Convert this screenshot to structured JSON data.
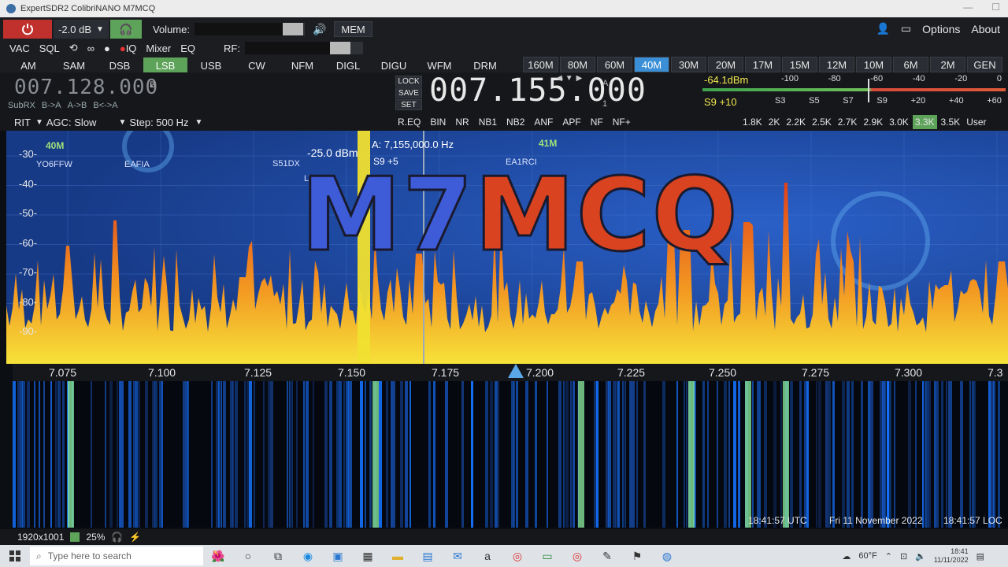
{
  "window": {
    "title": "ExpertSDR2 ColibriNANO    M7MCQ"
  },
  "toolbar": {
    "gain_value": "-2.0 dB",
    "volume_label": "Volume:",
    "volume_level": 0.75,
    "mem_label": "MEM",
    "rf_label": "RF:",
    "rf_level": 0.85,
    "options_label": "Options",
    "about_label": "About",
    "vac_label": "VAC",
    "sql_label": "SQL",
    "iq_label": "IQ",
    "mixer_label": "Mixer",
    "eq_label": "EQ"
  },
  "modes": [
    "AM",
    "SAM",
    "DSB",
    "LSB",
    "USB",
    "CW",
    "NFM",
    "DIGL",
    "DIGU",
    "WFM",
    "DRM"
  ],
  "active_mode": "LSB",
  "bands": [
    "160M",
    "80M",
    "60M",
    "40M",
    "30M",
    "20M",
    "17M",
    "15M",
    "12M",
    "10M",
    "6M",
    "2M",
    "GEN"
  ],
  "active_band": "40M",
  "vfo_b": {
    "frequency": "007.128.000",
    "label": "B",
    "subrx": "SubRX",
    "b_to_a": "B->A",
    "a_to_b": "A->B",
    "swap": "B<->A"
  },
  "vfo_a": {
    "frequency": "007.155.000",
    "label": "A",
    "sub": "1",
    "lock": "LOCK",
    "save": "SAVE",
    "set": "SET"
  },
  "smeter": {
    "dbm": "-64.1dBm",
    "s_reading": "S9 +10",
    "top_scale": [
      "-100",
      "-80",
      "-60",
      "-40",
      "-20",
      "0"
    ],
    "bottom_scale": [
      "S3",
      "S5",
      "S7",
      "S9",
      "+20",
      "+40",
      "+60"
    ]
  },
  "controls": {
    "rit": "RIT",
    "agc": "AGC: Slow",
    "step": "Step: 500 Hz"
  },
  "dsp_buttons": [
    "R.EQ",
    "BIN",
    "NR",
    "NB1",
    "NB2",
    "ANF",
    "APF",
    "NF",
    "NF+"
  ],
  "filters": [
    "1.8K",
    "2K",
    "2.2K",
    "2.5K",
    "2.7K",
    "2.9K",
    "3.0K",
    "3.3K",
    "3.5K",
    "User"
  ],
  "active_filter": "3.3K",
  "spectrum": {
    "band_label": "40M",
    "next_band_label": "41M",
    "dbm_levels": [
      "-30-",
      "-40-",
      "-50-",
      "-60-",
      "-70-",
      "-80-",
      "-90-"
    ],
    "cursor_dbm": "-25.0 dBm",
    "cursor_freq": "A: 7,155,000.0 Hz",
    "cursor_s": "S9 +5",
    "spots": [
      "YO6FFW",
      "EAFIA",
      "S51DX",
      "LY4L",
      "EA1RCI"
    ],
    "callsign_overlay_a": "M7",
    "callsign_overlay_b": "MCQ"
  },
  "freq_axis": [
    "7.075",
    "7.100",
    "7.125",
    "7.150",
    "7.175",
    "7.200",
    "7.225",
    "7.250",
    "7.275",
    "7.300",
    "7.3"
  ],
  "status": {
    "utc": "18:41:57 UTC",
    "date": "Fri 11 November 2022",
    "local": "18:41:57 LOC",
    "resolution": "1920x1001",
    "cpu": "25%"
  },
  "taskbar": {
    "search_placeholder": "Type here to search",
    "weather": "60°F",
    "time": "18:41",
    "date": "11/11/2022"
  }
}
